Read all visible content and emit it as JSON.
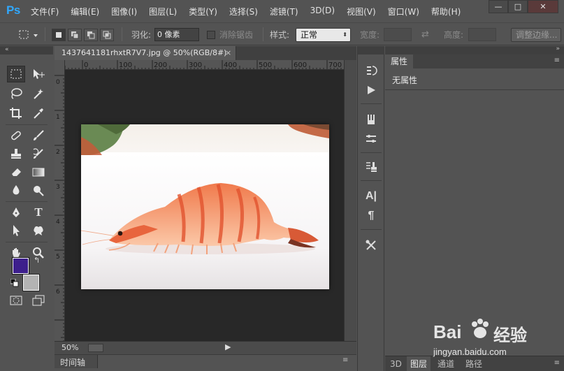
{
  "app": {
    "logo": "Ps"
  },
  "menu": [
    "文件(F)",
    "编辑(E)",
    "图像(I)",
    "图层(L)",
    "类型(Y)",
    "选择(S)",
    "滤镜(T)",
    "3D(D)",
    "视图(V)",
    "窗口(W)",
    "帮助(H)"
  ],
  "window_controls": {
    "minimize": "—",
    "maximize": "□",
    "close": "✕"
  },
  "options": {
    "feather_label": "羽化:",
    "feather_value": "0 像素",
    "antialias_label": "消除锯齿",
    "style_label": "样式:",
    "style_value": "正常",
    "width_label": "宽度:",
    "height_label": "高度:",
    "refine_edge": "调整边缘..."
  },
  "document": {
    "tab_title": "1437641181rhxtR7V7.jpg @ 50%(RGB/8#)",
    "tab_close": "×",
    "ruler_h_labels": [
      "0",
      "100",
      "200",
      "300",
      "400",
      "500",
      "600",
      "700"
    ],
    "ruler_v_labels": [
      "0",
      "1",
      "2",
      "3",
      "4",
      "5",
      "6"
    ],
    "zoom": "50%",
    "timeline_label": "时间轴"
  },
  "colors": {
    "foreground": "#3d1f8c",
    "background": "#b3b3b3",
    "ps_blue": "#31a8ff"
  },
  "properties": {
    "tab_label": "属性",
    "empty_text": "无属性"
  },
  "layers_tabs": [
    "3D",
    "图层",
    "通道",
    "路径"
  ],
  "watermark": {
    "brand": "Bai",
    "brand2": "经验",
    "url": "jingyan.baidu.com"
  }
}
